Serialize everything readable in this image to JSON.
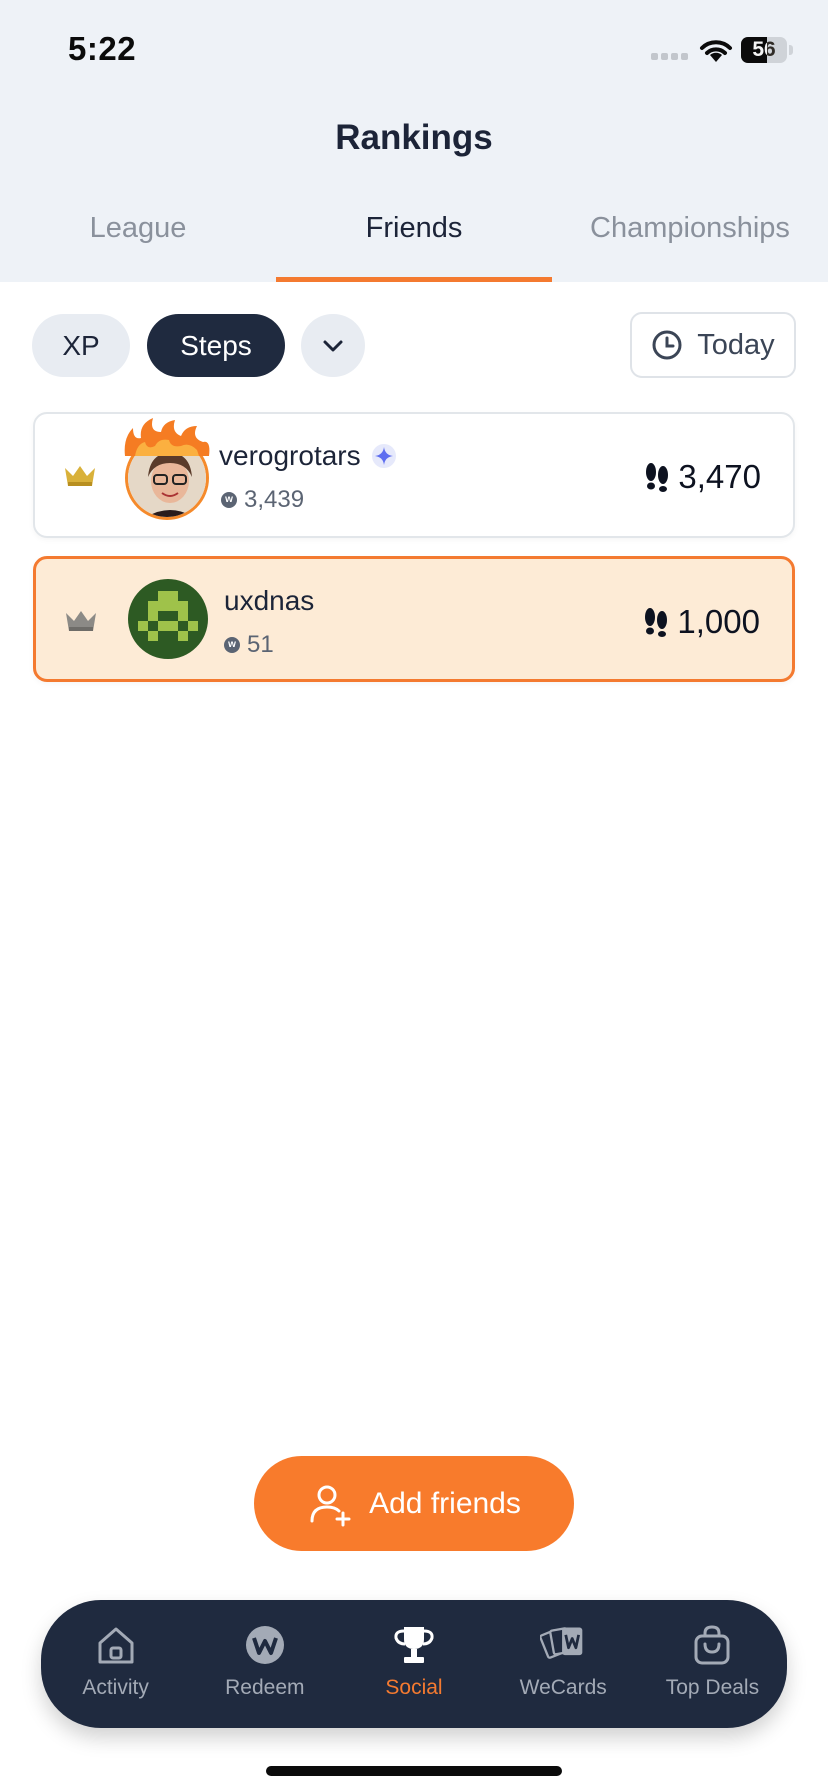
{
  "status_bar": {
    "time": "5:22",
    "battery": "56"
  },
  "header": {
    "title": "Rankings"
  },
  "tabs": [
    {
      "label": "League"
    },
    {
      "label": "Friends"
    },
    {
      "label": "Championships"
    }
  ],
  "filters": {
    "xp_label": "XP",
    "steps_label": "Steps",
    "period_label": "Today"
  },
  "rankings": [
    {
      "name": "verogrotars",
      "xp": "3,439",
      "steps": "3,470"
    },
    {
      "name": "uxdnas",
      "xp": "51",
      "steps": "1,000"
    }
  ],
  "add_friends_label": "Add friends",
  "nav": [
    {
      "label": "Activity"
    },
    {
      "label": "Redeem"
    },
    {
      "label": "Social"
    },
    {
      "label": "WeCards"
    },
    {
      "label": "Top Deals"
    }
  ],
  "colors": {
    "accent": "#f47a30",
    "dark": "#1f2a3f"
  }
}
